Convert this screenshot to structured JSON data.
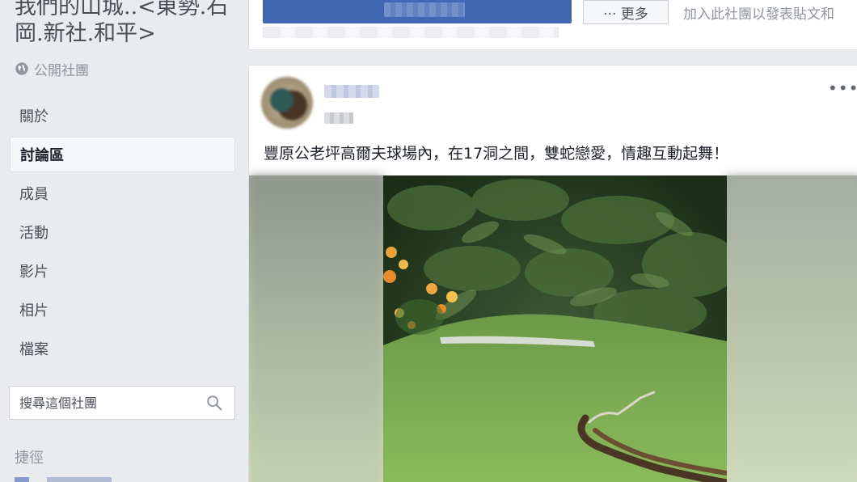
{
  "group": {
    "title": "我們的山城..<東勢.石岡.新社.和平>",
    "privacy_label": "公開社團",
    "privacy_icon": "globe-icon"
  },
  "nav": {
    "items": [
      {
        "label": "關於",
        "active": false
      },
      {
        "label": "討論區",
        "active": true
      },
      {
        "label": "成員",
        "active": false
      },
      {
        "label": "活動",
        "active": false
      },
      {
        "label": "影片",
        "active": false
      },
      {
        "label": "相片",
        "active": false
      },
      {
        "label": "檔案",
        "active": false
      }
    ]
  },
  "search": {
    "placeholder": "搜尋這個社團",
    "icon": "search-icon"
  },
  "shortcuts": {
    "label": "捷徑"
  },
  "top_card": {
    "more_label": "··· 更多",
    "join_hint": "加入此社團以發表貼文和"
  },
  "post": {
    "menu_label": "•••",
    "text": "豐原公老坪高爾夫球場內，在17洞之間，雙蛇戀愛，情趣互動起舞！"
  },
  "colors": {
    "accent": "#4267b2",
    "page_bg": "#e9ebee",
    "card_bg": "#ffffff"
  }
}
